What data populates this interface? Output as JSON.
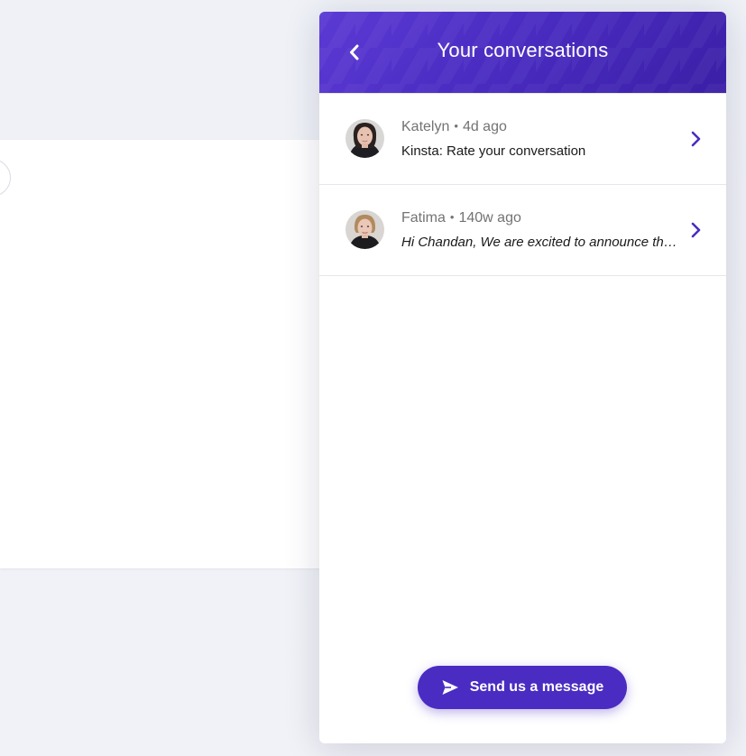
{
  "messenger": {
    "header": {
      "title": "Your conversations",
      "back_icon": "chevron-left-icon"
    },
    "conversations": [
      {
        "name": "Katelyn",
        "separator": "•",
        "time": "4d ago",
        "preview": "Kinsta: Rate your conversation",
        "preview_style": "normal"
      },
      {
        "name": "Fatima",
        "separator": "•",
        "time": "140w ago",
        "preview": "Hi Chandan, We are excited to announce the launch of our new",
        "preview_style": "italic"
      }
    ],
    "send_button": {
      "label": "Send us a message",
      "icon": "send-icon"
    }
  },
  "colors": {
    "brand": "#4a2cc2",
    "header_gradient_start": "#5b3ad4",
    "header_gradient_end": "#3b1fa6",
    "chevron": "#4a2cc2",
    "meta_text": "#737376",
    "preview_text": "#1a1a1a"
  }
}
